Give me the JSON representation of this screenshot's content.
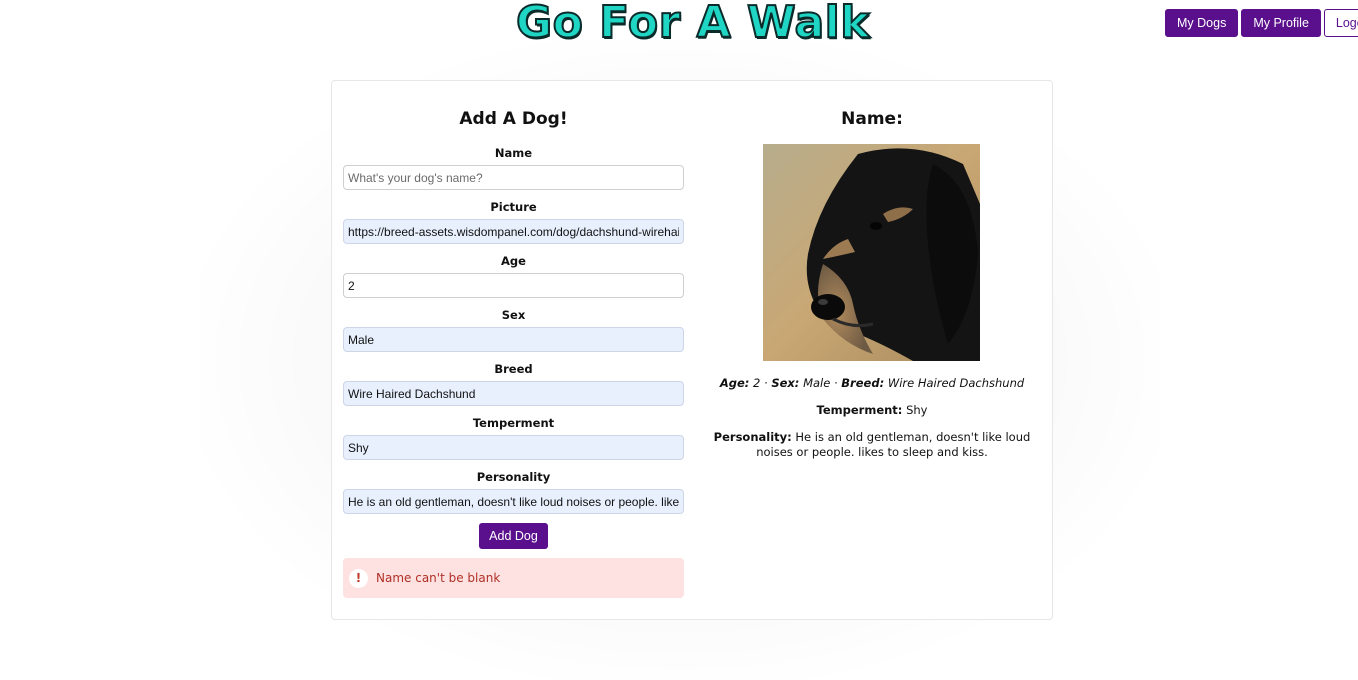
{
  "header": {
    "logo_text": "Go For A Walk"
  },
  "nav": {
    "my_dogs": "My Dogs",
    "my_profile": "My Profile",
    "logout": "Logout"
  },
  "form": {
    "title": "Add A Dog!",
    "fields": {
      "name": {
        "label": "Name",
        "value": "",
        "placeholder": "What's your dog's name?"
      },
      "picture": {
        "label": "Picture",
        "value": "https://breed-assets.wisdompanel.com/dog/dachshund-wirehaired"
      },
      "age": {
        "label": "Age",
        "value": "2"
      },
      "sex": {
        "label": "Sex",
        "value": "Male"
      },
      "breed": {
        "label": "Breed",
        "value": "Wire Haired Dachshund"
      },
      "temperment": {
        "label": "Temperment",
        "value": "Shy"
      },
      "personality": {
        "label": "Personality",
        "value": "He is an old gentleman, doesn't like loud noises or people. likes to sleep and kiss."
      }
    },
    "submit_label": "Add Dog",
    "error": {
      "icon": "!",
      "message": "Name can't be blank"
    }
  },
  "preview": {
    "title": "Name:",
    "age_label": "Age:",
    "age_value": "2",
    "sex_label": "Sex:",
    "sex_value": "Male",
    "breed_label": "Breed:",
    "breed_value": "Wire Haired Dachshund",
    "separator": "·",
    "temperment_label": "Temperment:",
    "temperment_value": "Shy",
    "personality_label": "Personality:",
    "personality_value": "He is an old gentleman, doesn't like loud noises or people. likes to sleep and kiss."
  },
  "colors": {
    "brand_purple": "#5a0f8c",
    "logo_teal": "#1fd5c4",
    "error_bg": "#fde2e1",
    "autofill_bg": "#e8f0fe"
  }
}
